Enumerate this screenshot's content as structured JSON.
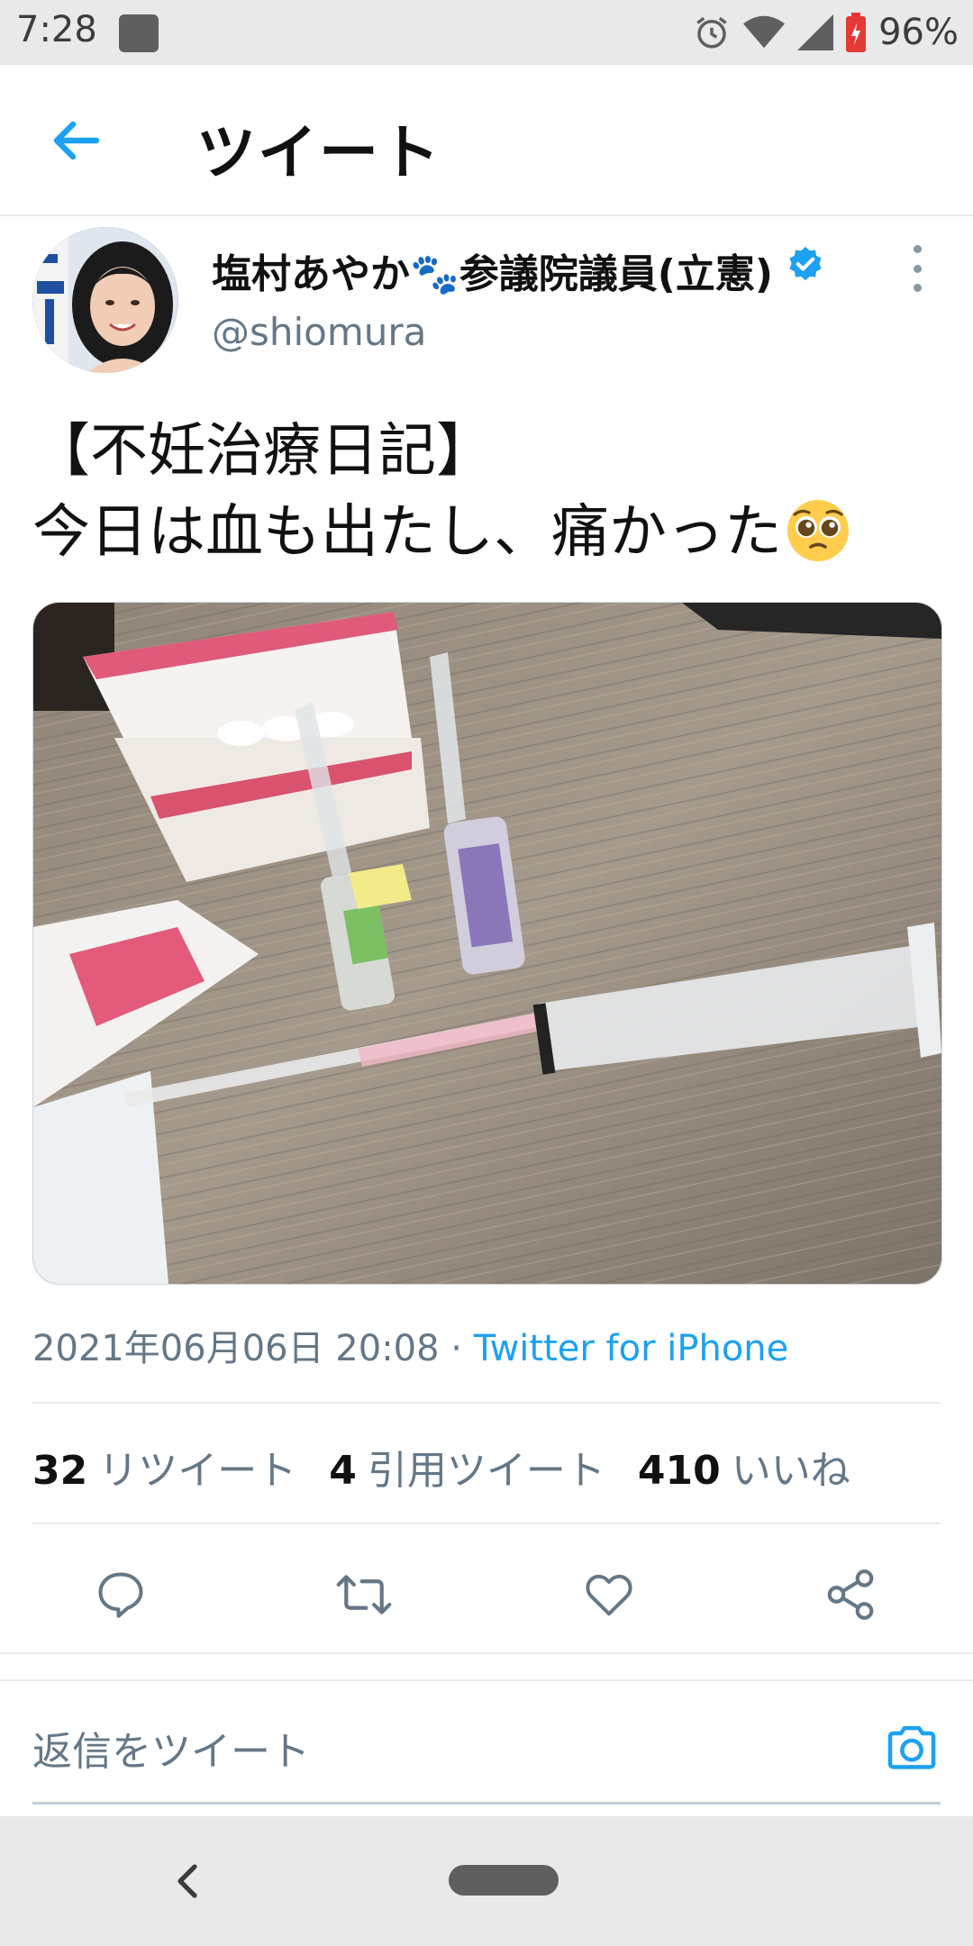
{
  "status_bar": {
    "time": "7:28",
    "battery_percent": "96%",
    "icons": [
      "app-notification-icon",
      "alarm-icon",
      "wifi-icon",
      "signal-icon",
      "battery-icon"
    ]
  },
  "app_bar": {
    "title": "ツイート",
    "back_icon": "arrow-left-icon"
  },
  "tweet": {
    "author_name": "塩村あやか🐾参議院議員(立憲)",
    "handle": "@shiomura",
    "verified": true,
    "text_line1": "【不妊治療日記】",
    "text_line2": "今日は血も出たし、痛かった",
    "emoji": "pleading-face-emoji",
    "timestamp": "2021年06月06日 20:08",
    "separator": " · ",
    "source": "Twitter for iPhone"
  },
  "stats": {
    "retweets_count": "32",
    "retweets_label": "リツイート",
    "quotes_count": "4",
    "quotes_label": "引用ツイート",
    "likes_count": "410",
    "likes_label": "いいね"
  },
  "reply": {
    "placeholder": "返信をツイート"
  },
  "colors": {
    "accent": "#1da1f2",
    "secondary_text": "#657786",
    "primary_text": "#0f1419",
    "system_bar": "#e9e9e9"
  }
}
